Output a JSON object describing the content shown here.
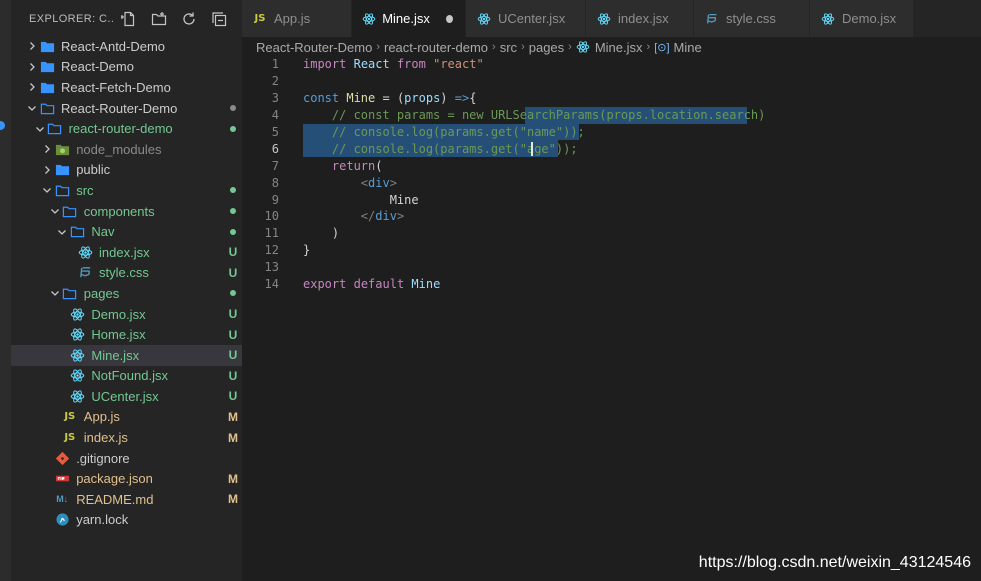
{
  "explorer": {
    "title": "EXPLORER: C...",
    "actions": [
      "new-file-icon",
      "new-folder-icon",
      "refresh-icon",
      "collapse-all-icon"
    ],
    "tree": [
      {
        "label": "React-Antd-Demo",
        "type": "folder",
        "expanded": false,
        "depth": 0,
        "status": "",
        "icon": "folder-icon"
      },
      {
        "label": "React-Demo",
        "type": "folder",
        "expanded": false,
        "depth": 0,
        "status": "",
        "icon": "folder-icon"
      },
      {
        "label": "React-Fetch-Demo",
        "type": "folder",
        "expanded": false,
        "depth": 0,
        "status": "",
        "icon": "folder-icon"
      },
      {
        "label": "React-Router-Demo",
        "type": "folder",
        "expanded": true,
        "depth": 0,
        "status": "dot",
        "icon": "folder-open-icon"
      },
      {
        "label": "react-router-demo",
        "type": "folder",
        "expanded": true,
        "depth": 1,
        "status": "dot",
        "icon": "folder-open-icon",
        "color": "green"
      },
      {
        "label": "node_modules",
        "type": "folder",
        "expanded": false,
        "depth": 2,
        "status": "",
        "icon": "node-folder-icon",
        "color": "dim"
      },
      {
        "label": "public",
        "type": "folder",
        "expanded": false,
        "depth": 2,
        "status": "",
        "icon": "folder-icon"
      },
      {
        "label": "src",
        "type": "folder",
        "expanded": true,
        "depth": 2,
        "status": "dot",
        "icon": "folder-open-icon",
        "color": "green"
      },
      {
        "label": "components",
        "type": "folder",
        "expanded": true,
        "depth": 3,
        "status": "dot",
        "icon": "folder-open-icon",
        "color": "green"
      },
      {
        "label": "Nav",
        "type": "folder",
        "expanded": true,
        "depth": 4,
        "status": "dot",
        "icon": "folder-open-icon",
        "color": "green"
      },
      {
        "label": "index.jsx",
        "type": "file",
        "depth": 5,
        "status": "U",
        "icon": "react-icon",
        "color": "green"
      },
      {
        "label": "style.css",
        "type": "file",
        "depth": 5,
        "status": "U",
        "icon": "css-icon",
        "color": "green"
      },
      {
        "label": "pages",
        "type": "folder",
        "expanded": true,
        "depth": 3,
        "status": "dot",
        "icon": "folder-open-icon",
        "color": "green"
      },
      {
        "label": "Demo.jsx",
        "type": "file",
        "depth": 4,
        "status": "U",
        "icon": "react-icon",
        "color": "green"
      },
      {
        "label": "Home.jsx",
        "type": "file",
        "depth": 4,
        "status": "U",
        "icon": "react-icon",
        "color": "green"
      },
      {
        "label": "Mine.jsx",
        "type": "file",
        "depth": 4,
        "status": "U",
        "icon": "react-icon",
        "color": "green",
        "active": true
      },
      {
        "label": "NotFound.jsx",
        "type": "file",
        "depth": 4,
        "status": "U",
        "icon": "react-icon",
        "color": "green"
      },
      {
        "label": "UCenter.jsx",
        "type": "file",
        "depth": 4,
        "status": "U",
        "icon": "react-icon",
        "color": "green"
      },
      {
        "label": "App.js",
        "type": "file",
        "depth": 3,
        "status": "M",
        "icon": "js-icon",
        "color": "amber"
      },
      {
        "label": "index.js",
        "type": "file",
        "depth": 3,
        "status": "M",
        "icon": "js-icon",
        "color": "amber"
      },
      {
        "label": ".gitignore",
        "type": "file",
        "depth": 2,
        "status": "",
        "icon": "git-icon"
      },
      {
        "label": "package.json",
        "type": "file",
        "depth": 2,
        "status": "M",
        "icon": "npm-icon",
        "color": "amber"
      },
      {
        "label": "README.md",
        "type": "file",
        "depth": 2,
        "status": "M",
        "icon": "markdown-icon",
        "color": "amber"
      },
      {
        "label": "yarn.lock",
        "type": "file",
        "depth": 2,
        "status": "",
        "icon": "yarn-icon"
      }
    ]
  },
  "tabs": [
    {
      "label": "App.js",
      "icon": "js-icon",
      "active": false
    },
    {
      "label": "Mine.jsx",
      "icon": "react-icon",
      "active": true,
      "dirty": true
    },
    {
      "label": "UCenter.jsx",
      "icon": "react-icon",
      "active": false
    },
    {
      "label": "index.jsx",
      "icon": "react-icon",
      "active": false
    },
    {
      "label": "style.css",
      "icon": "css-icon",
      "active": false
    },
    {
      "label": "Demo.jsx",
      "icon": "react-icon",
      "active": false
    }
  ],
  "breadcrumb": [
    "React-Router-Demo",
    "react-router-demo",
    "src",
    "pages",
    "Mine.jsx",
    "Mine"
  ],
  "editor": {
    "current_line": 6,
    "lines": [
      "import React from \"react\"",
      "",
      "const Mine = (props) =>{",
      "    // const params = new URLSearchParams(props.location.search)",
      "    // console.log(params.get(\"name\"));",
      "    // console.log(params.get(\"age\"));",
      "    return(",
      "        <div>",
      "            Mine",
      "        </div>",
      "    )",
      "}",
      "",
      "export default Mine"
    ]
  },
  "watermark": "https://blog.csdn.net/weixin_43124546",
  "colors": {
    "background": "#1e1e1e",
    "sidebar": "#252526",
    "selection": "#264f78",
    "untracked": "#73c991",
    "modified": "#e2c08d",
    "react": "#61dafb"
  }
}
